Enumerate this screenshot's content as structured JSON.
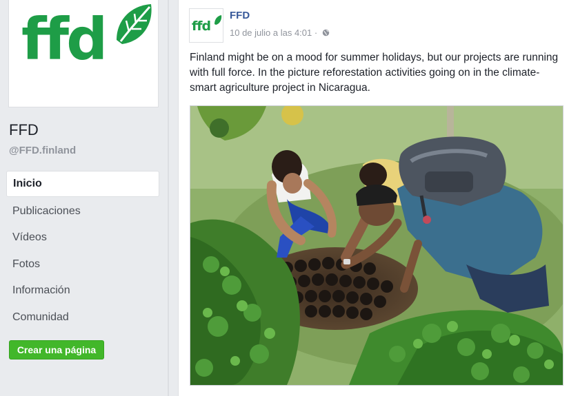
{
  "page": {
    "logo_text": "ffd",
    "name": "FFD",
    "handle": "@FFD.finland",
    "brand_color": "#1e9d47"
  },
  "nav": {
    "items": [
      {
        "label": "Inicio",
        "active": true
      },
      {
        "label": "Publicaciones",
        "active": false
      },
      {
        "label": "Vídeos",
        "active": false
      },
      {
        "label": "Fotos",
        "active": false
      },
      {
        "label": "Información",
        "active": false
      },
      {
        "label": "Comunidad",
        "active": false
      }
    ],
    "create_button": "Crear una página"
  },
  "post": {
    "author": "FFD",
    "avatar_text": "ffd",
    "timestamp": "10 de julio a las 4:01 ·",
    "privacy_icon": "globe-icon",
    "text": "Finland might be on a mood for summer holidays, but our projects are running with full force. In the picture reforestation activities going on in the climate-smart agriculture project in Nicaragua."
  },
  "colors": {
    "background": "#e9ebee",
    "link": "#365899",
    "create_button": "#42b72a"
  }
}
